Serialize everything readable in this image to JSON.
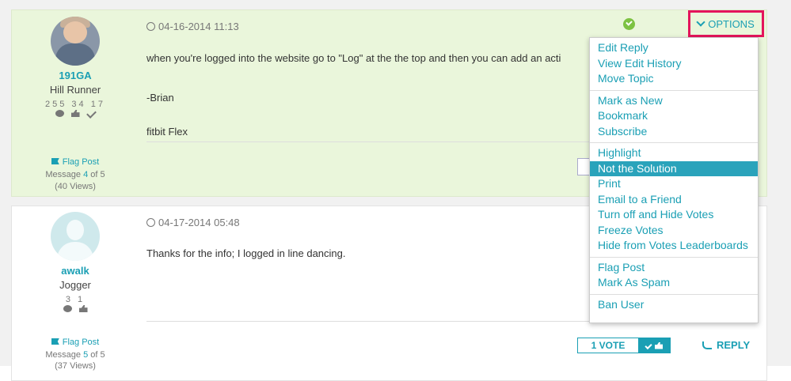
{
  "posts": [
    {
      "author": "191GA",
      "rank": "Hill Runner",
      "stats": [
        "255",
        "34",
        "17"
      ],
      "date": "04-16-2014 11:13",
      "body": [
        "when you're logged into the website go to \"Log\" at the the top and then you can add an acti",
        "-Brian",
        "fitbit Flex"
      ],
      "flag": "Flag Post",
      "message_prefix": "Message ",
      "message_num": "4",
      "message_suffix": " of 5",
      "views": "(40 Views)"
    },
    {
      "author": "awalk",
      "rank": "Jogger",
      "stats": [
        "3",
        "1"
      ],
      "date": "04-17-2014 05:48",
      "body": [
        "Thanks for the info; I logged in line dancing."
      ],
      "flag": "Flag Post",
      "message_prefix": "Message ",
      "message_num": "5",
      "message_suffix": " of 5",
      "views": "(37 Views)",
      "vote_count": "1 VOTE",
      "reply": "REPLY"
    }
  ],
  "options_button": "OPTIONS",
  "options_menu": [
    [
      "Edit Reply",
      "View Edit History",
      "Move Topic"
    ],
    [
      "Mark as New",
      "Bookmark",
      "Subscribe"
    ],
    [
      "Highlight",
      "Not the Solution",
      "Print",
      "Email to a Friend",
      "Turn off and Hide Votes",
      "Freeze Votes",
      "Hide from Votes Leaderboards"
    ],
    [
      "Flag Post",
      "Mark As Spam"
    ],
    [
      "Ban User"
    ]
  ],
  "active_menu_item": "Not the Solution",
  "colors": {
    "accent": "#1a9fb4",
    "highlight": "#e4145c",
    "solved_bg": "#eaf6db"
  }
}
